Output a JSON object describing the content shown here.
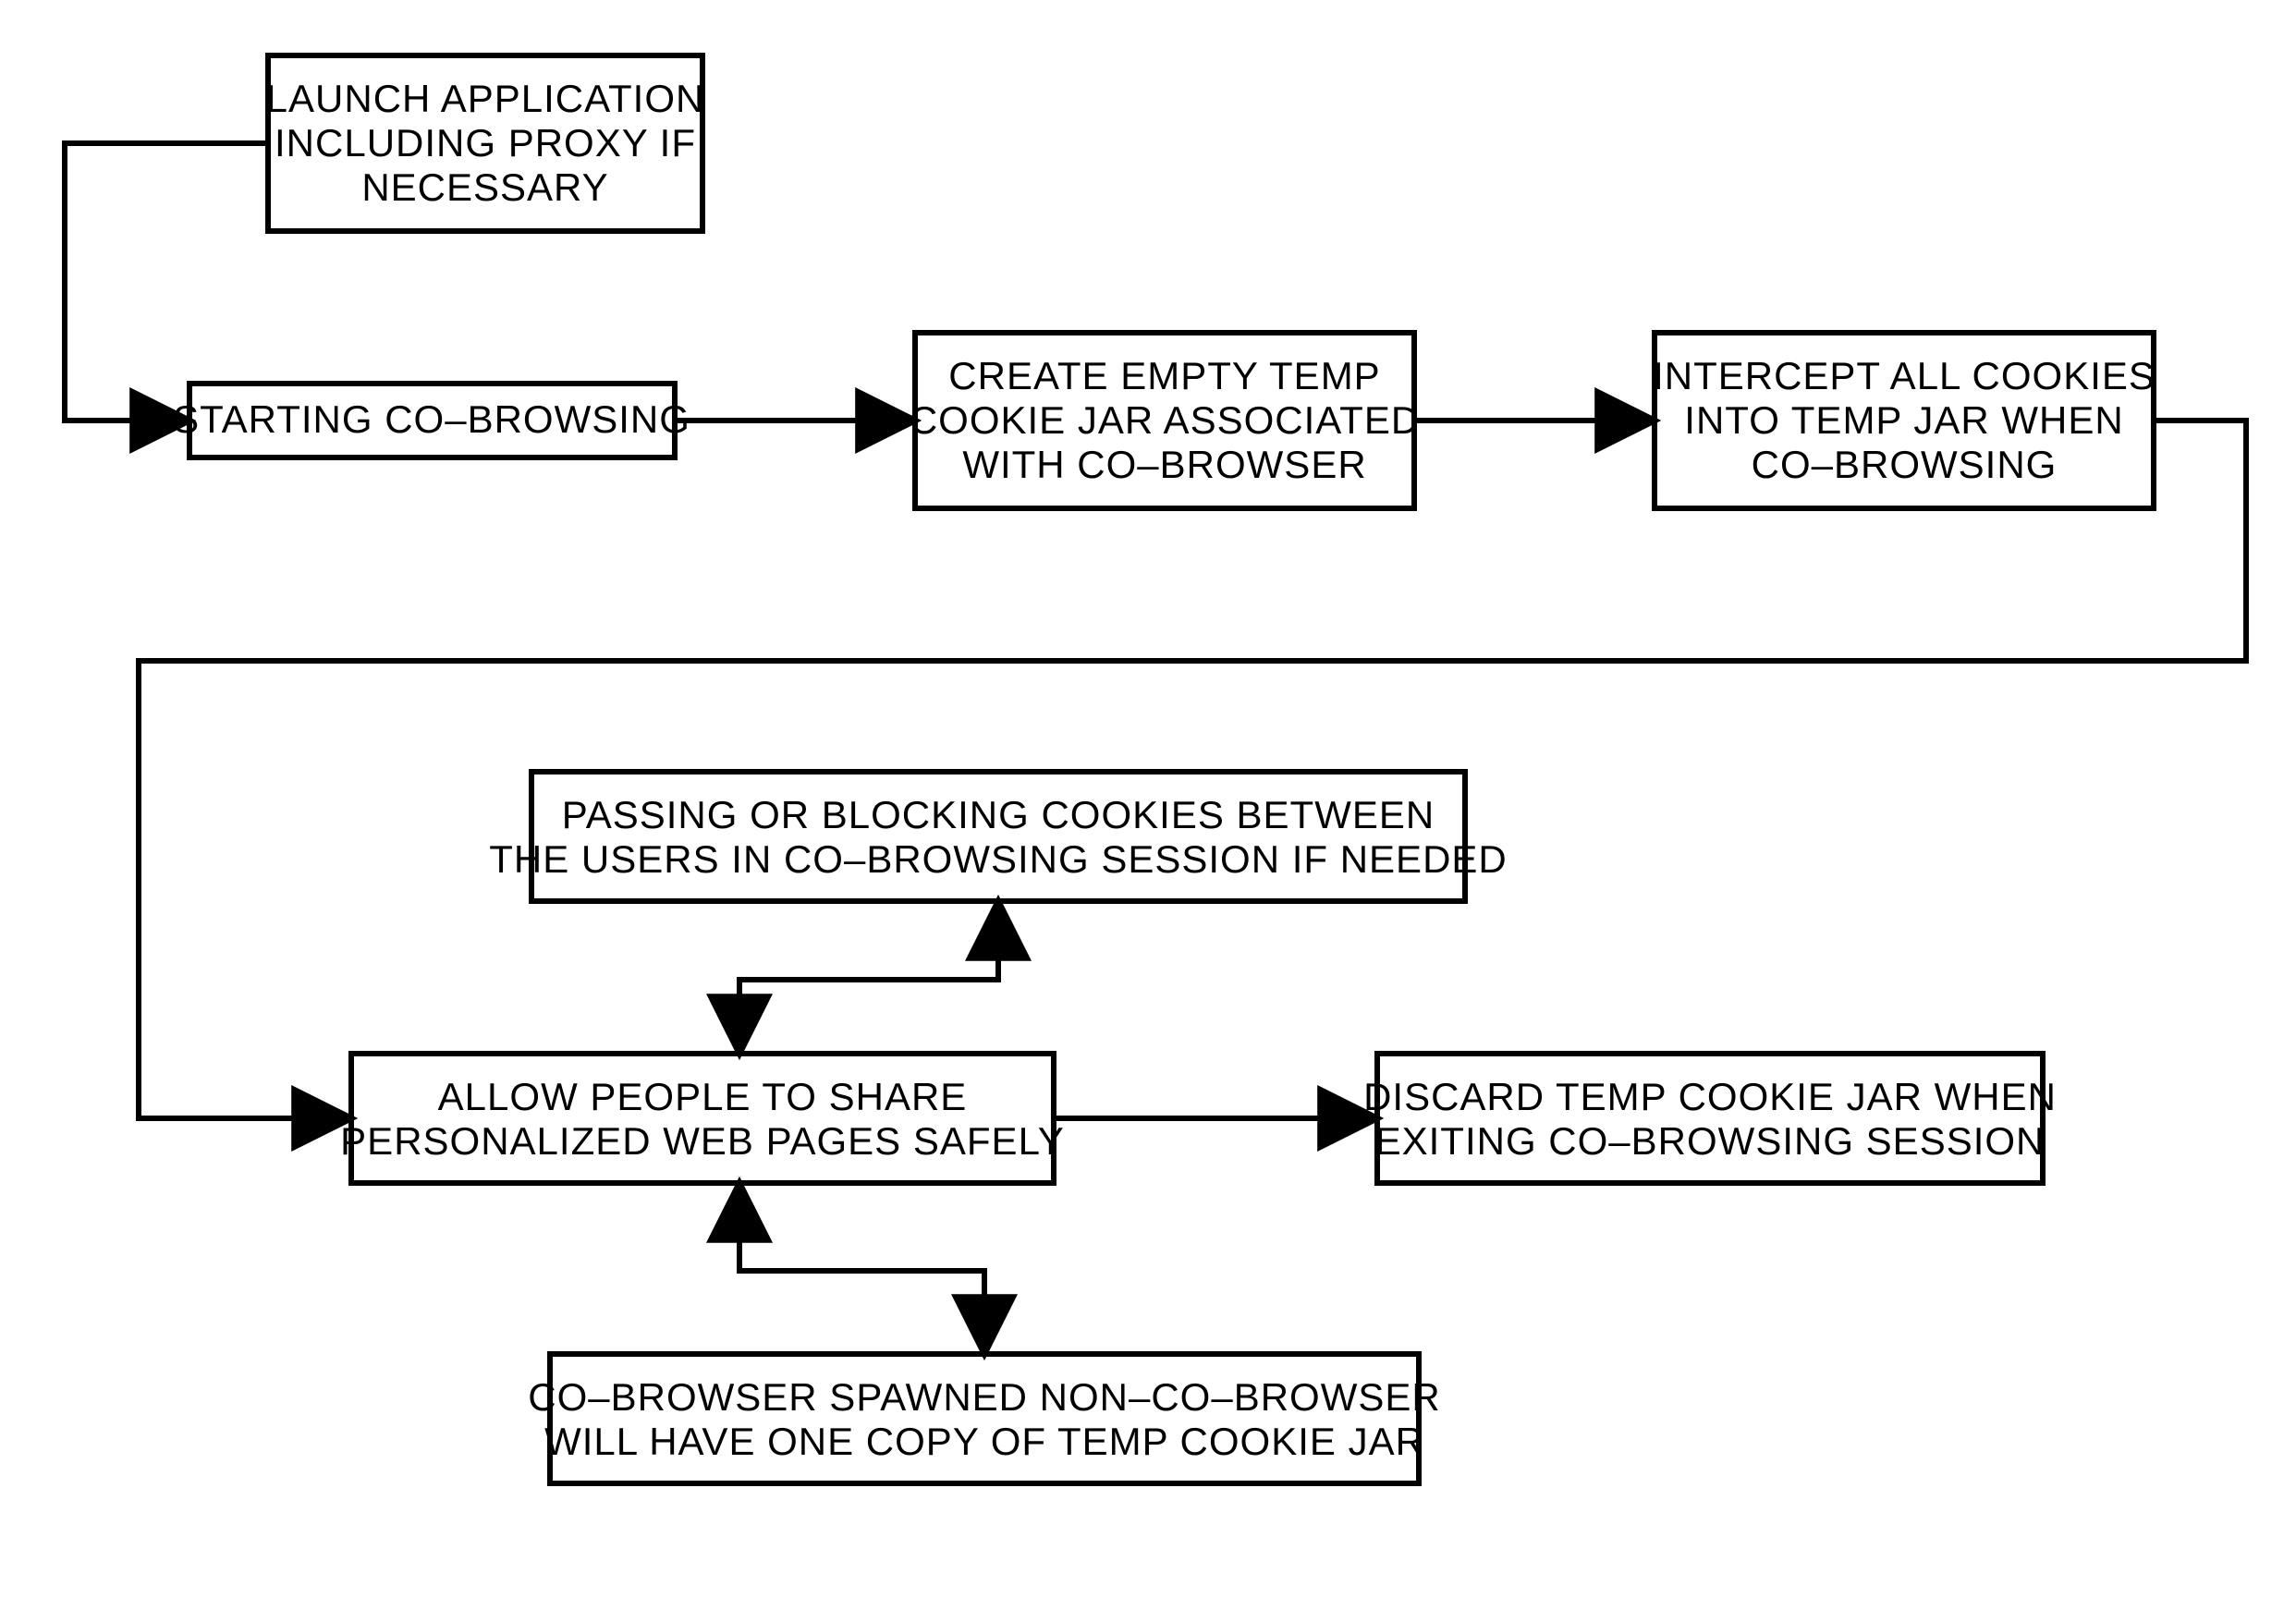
{
  "diagram": {
    "type": "flowchart",
    "boxes": {
      "launch": {
        "lines": [
          "LAUNCH APPLICATION",
          "INCLUDING PROXY IF",
          "NECESSARY"
        ]
      },
      "start": {
        "lines": [
          "STARTING CO–BROWSING"
        ]
      },
      "create": {
        "lines": [
          "CREATE EMPTY TEMP",
          "COOKIE JAR ASSOCIATED",
          "WITH CO–BROWSER"
        ]
      },
      "intercept": {
        "lines": [
          "INTERCEPT ALL COOKIES",
          "INTO TEMP JAR WHEN",
          "CO–BROWSING"
        ]
      },
      "passing": {
        "lines": [
          "PASSING OR BLOCKING COOKIES BETWEEN",
          "THE USERS IN CO–BROWSING SESSION IF NEEDED"
        ]
      },
      "allow": {
        "lines": [
          "ALLOW PEOPLE TO SHARE",
          "PERSONALIZED WEB PAGES SAFELY"
        ]
      },
      "discard": {
        "lines": [
          "DISCARD TEMP COOKIE JAR WHEN",
          "EXITING CO–BROWSING SESSION"
        ]
      },
      "spawned": {
        "lines": [
          "CO–BROWSER SPAWNED NON–CO–BROWSER",
          "WILL HAVE ONE COPY OF TEMP COOKIE JAR"
        ]
      }
    }
  }
}
